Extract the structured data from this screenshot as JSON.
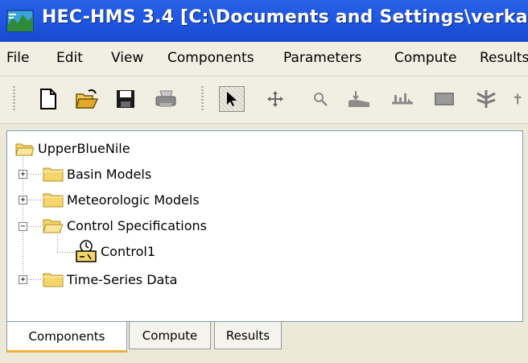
{
  "window": {
    "title": "HEC-HMS 3.4 [C:\\Documents and Settings\\verkade",
    "icon": "hec-hms-app-icon"
  },
  "menubar": {
    "items": [
      "File",
      "Edit",
      "View",
      "Components",
      "Parameters",
      "Compute",
      "Results"
    ]
  },
  "toolbar": {
    "buttons": [
      {
        "icon": "new-file-icon"
      },
      {
        "icon": "open-folder-icon"
      },
      {
        "icon": "save-icon"
      },
      {
        "icon": "print-icon"
      },
      {
        "icon": "select-arrow-icon",
        "pressed": true
      },
      {
        "icon": "pan-move-icon"
      },
      {
        "icon": "zoom-icon"
      },
      {
        "icon": "subbasin-creation-icon"
      },
      {
        "icon": "reach-creation-icon"
      },
      {
        "icon": "reservoir-creation-icon"
      },
      {
        "icon": "junction-creation-icon"
      },
      {
        "icon": "diversion-creation-icon"
      }
    ]
  },
  "tree": {
    "root": "UpperBlueNile",
    "children": [
      {
        "label": "Basin Models",
        "expanded": false
      },
      {
        "label": "Meteorologic Models",
        "expanded": false
      },
      {
        "label": "Control Specifications",
        "expanded": true,
        "children": [
          {
            "label": "Control1"
          }
        ]
      },
      {
        "label": "Time-Series Data",
        "expanded": false
      }
    ]
  },
  "tabs": {
    "items": [
      "Components",
      "Compute",
      "Results"
    ],
    "active": "Components"
  },
  "colors": {
    "titlebar": "#1f56e0",
    "folder": "#f5d66a",
    "active_tab_accent": "#f0b33c"
  }
}
